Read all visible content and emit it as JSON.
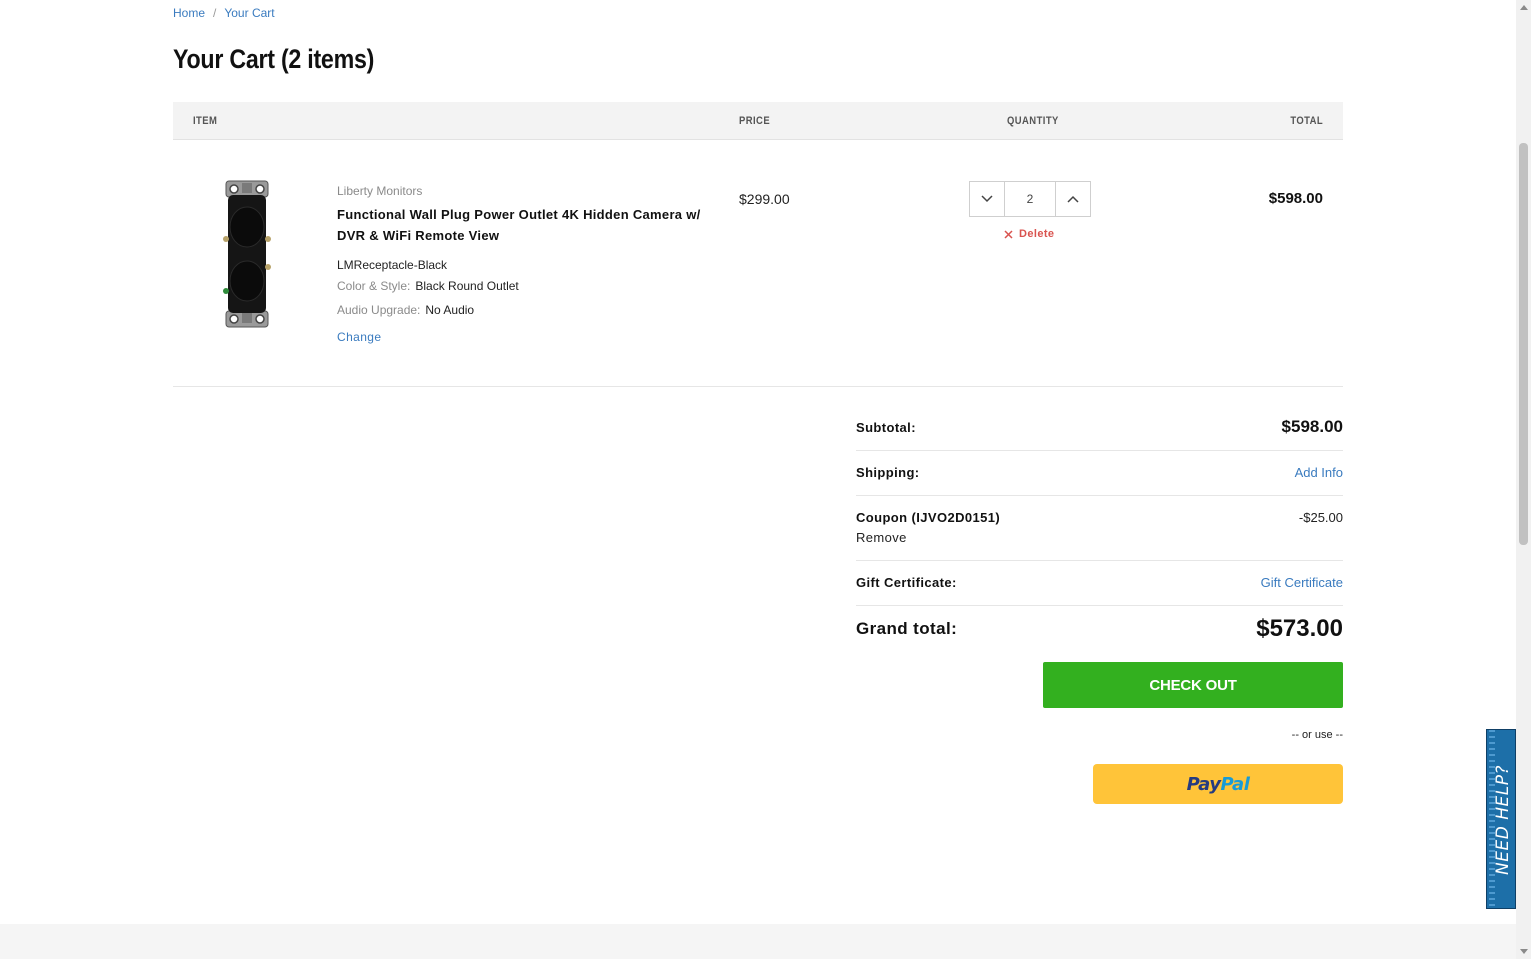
{
  "breadcrumb": {
    "home": "Home",
    "separator": "/",
    "current": "Your Cart"
  },
  "page_title": "Your Cart (2 items)",
  "table_headers": {
    "item": "ITEM",
    "price": "PRICE",
    "quantity": "QUANTITY",
    "total": "TOTAL"
  },
  "cart_item": {
    "brand": "Liberty Monitors",
    "name": "Functional Wall Plug Power Outlet 4K Hidden Camera w/ DVR & WiFi Remote View",
    "sku": "LMReceptacle-Black",
    "options": [
      {
        "label": "Color & Style:",
        "value": "Black Round Outlet"
      },
      {
        "label": "Audio Upgrade:",
        "value": "No Audio"
      }
    ],
    "change_label": "Change",
    "price": "$299.00",
    "quantity": "2",
    "delete_label": "Delete",
    "line_total": "$598.00"
  },
  "summary": {
    "subtotal_label": "Subtotal:",
    "subtotal_value": "$598.00",
    "shipping_label": "Shipping:",
    "shipping_value": "Add Info",
    "coupon_label": "Coupon (IJVO2D0151)",
    "coupon_remove": "Remove",
    "coupon_value": "-$25.00",
    "gift_label": "Gift Certificate:",
    "gift_value": "Gift Certificate",
    "grand_label": "Grand total:",
    "grand_value": "$573.00"
  },
  "checkout_label": "CHECK OUT",
  "or_use": "-- or use --",
  "paypal": {
    "part1": "Pay",
    "part2": "Pal"
  },
  "need_help": "NEED HELP?",
  "icons": {
    "qty_decrease": "chevron-down-icon",
    "qty_increase": "chevron-up-icon",
    "delete": "close-icon"
  },
  "colors": {
    "link": "#3a7bbf",
    "checkout": "#33b01f",
    "paypal": "#ffc439",
    "delete": "#d9534f",
    "help_tab": "#1d6fa8"
  }
}
